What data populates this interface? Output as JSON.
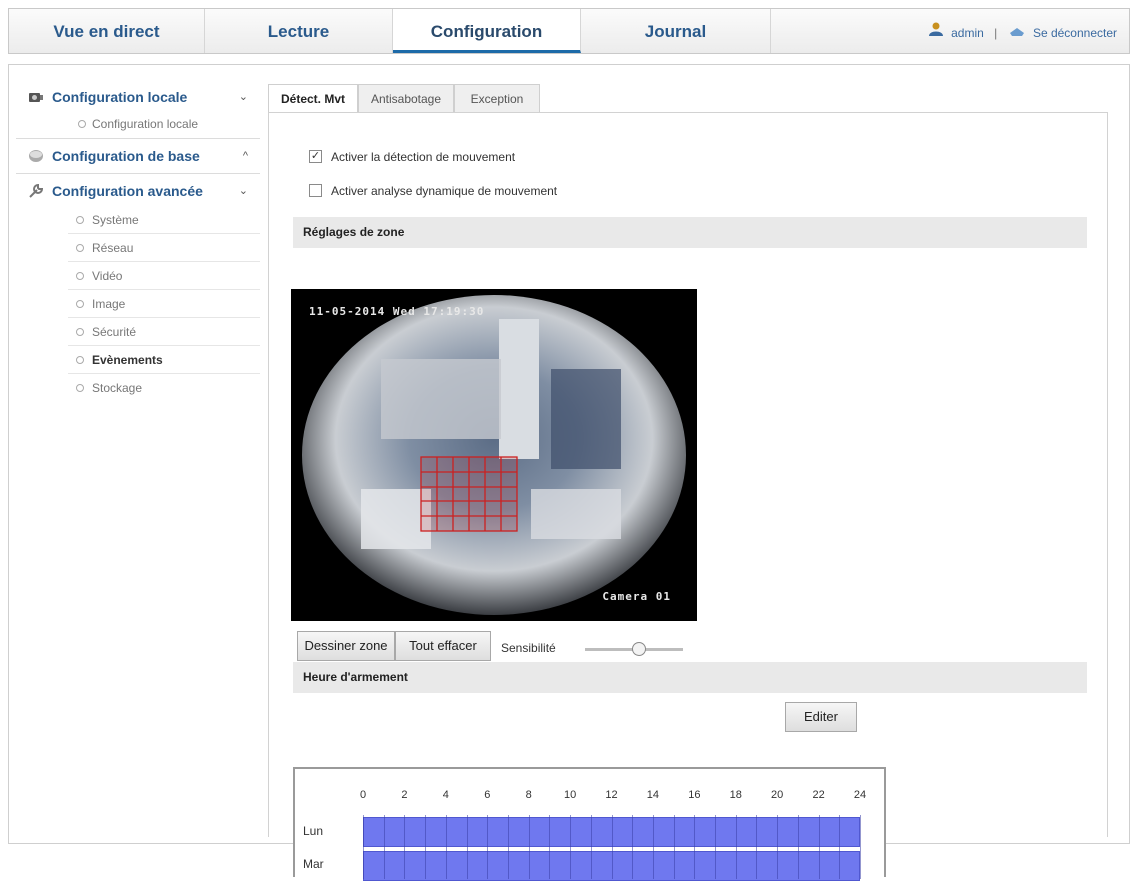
{
  "topnav": {
    "tabs": [
      {
        "label": "Vue en direct"
      },
      {
        "label": "Lecture"
      },
      {
        "label": "Configuration"
      },
      {
        "label": "Journal"
      }
    ],
    "user": "admin",
    "separator": "|",
    "logout": "Se déconnecter"
  },
  "sidebar": {
    "local": {
      "label": "Configuration locale",
      "caret": "⌄",
      "item": "Configuration locale"
    },
    "base": {
      "label": "Configuration de base",
      "caret": "^"
    },
    "advanced": {
      "label": "Configuration avancée",
      "caret": "⌄",
      "items": [
        {
          "label": "Système"
        },
        {
          "label": "Réseau"
        },
        {
          "label": "Vidéo"
        },
        {
          "label": "Image"
        },
        {
          "label": "Sécurité"
        },
        {
          "label": "Evènements"
        },
        {
          "label": "Stockage"
        }
      ]
    }
  },
  "content": {
    "tabs": [
      {
        "label": "Détect. Mvt"
      },
      {
        "label": "Antisabotage"
      },
      {
        "label": "Exception"
      }
    ],
    "enable_motion": {
      "label": "Activer la détection de mouvement",
      "checked": true
    },
    "enable_dynamic": {
      "label": "Activer analyse dynamique de mouvement",
      "checked": false
    },
    "zone_section": "Réglages de zone",
    "video": {
      "timestamp": "11-05-2014 Wed 17:19:30",
      "camera": "Camera 01"
    },
    "draw_button": "Dessiner zone",
    "clear_button": "Tout effacer",
    "sensitivity_label": "Sensibilité",
    "sensitivity_level": 0.5,
    "arming_section": "Heure d'armement",
    "edit_button": "Editer",
    "schedule": {
      "ticks": [
        "0",
        "2",
        "4",
        "6",
        "8",
        "10",
        "12",
        "14",
        "16",
        "18",
        "20",
        "22",
        "24"
      ],
      "days": [
        "Lun",
        "Mar"
      ]
    }
  }
}
